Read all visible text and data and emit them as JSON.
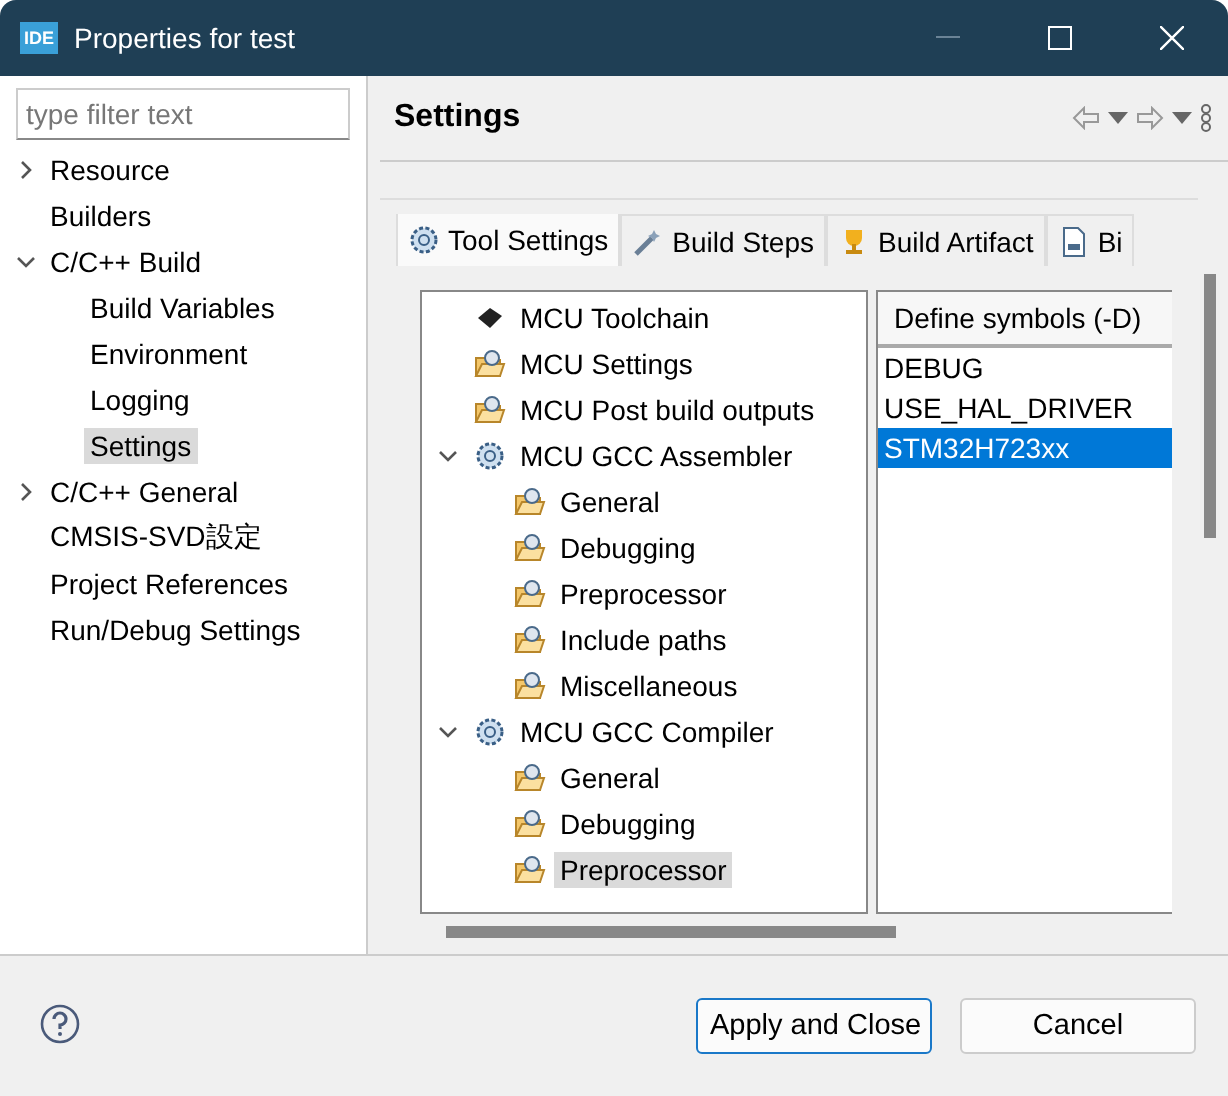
{
  "window": {
    "title": "Properties for test",
    "app_badge": "IDE"
  },
  "filter": {
    "placeholder": "type filter text"
  },
  "nav": [
    {
      "label": "Resource",
      "expanded": false,
      "selected": false
    },
    {
      "label": "Builders",
      "selected": false
    },
    {
      "label": "C/C++ Build",
      "expanded": true,
      "selected": false,
      "children": [
        {
          "label": "Build Variables",
          "selected": false
        },
        {
          "label": "Environment",
          "selected": false
        },
        {
          "label": "Logging",
          "selected": false
        },
        {
          "label": "Settings",
          "selected": true
        }
      ]
    },
    {
      "label": "C/C++ General",
      "expanded": false,
      "selected": false
    },
    {
      "label": "CMSIS-SVD設定",
      "selected": false
    },
    {
      "label": "Project References",
      "selected": false
    },
    {
      "label": "Run/Debug Settings",
      "selected": false
    }
  ],
  "page": {
    "title": "Settings"
  },
  "tabs": [
    {
      "label": "Tool Settings",
      "kind": "gear",
      "selected": true
    },
    {
      "label": "Build Steps",
      "kind": "wand",
      "selected": false
    },
    {
      "label": "Build Artifact",
      "kind": "trophy",
      "selected": false
    },
    {
      "label": "Bi",
      "kind": "binary",
      "selected": false
    }
  ],
  "tool_tree": [
    {
      "label": "MCU Toolchain",
      "kind": "chip",
      "selected": false
    },
    {
      "label": "MCU Settings",
      "kind": "folder",
      "selected": false
    },
    {
      "label": "MCU Post build outputs",
      "kind": "folder",
      "selected": false
    },
    {
      "label": "MCU GCC Assembler",
      "kind": "gear",
      "expanded": true,
      "selected": false,
      "children": [
        {
          "label": "General",
          "kind": "folder",
          "selected": false
        },
        {
          "label": "Debugging",
          "kind": "folder",
          "selected": false
        },
        {
          "label": "Preprocessor",
          "kind": "folder",
          "selected": false
        },
        {
          "label": "Include paths",
          "kind": "folder",
          "selected": false
        },
        {
          "label": "Miscellaneous",
          "kind": "folder",
          "selected": false
        }
      ]
    },
    {
      "label": "MCU GCC Compiler",
      "kind": "gear",
      "expanded": true,
      "selected": false,
      "children": [
        {
          "label": "General",
          "kind": "folder",
          "selected": false
        },
        {
          "label": "Debugging",
          "kind": "folder",
          "selected": false
        },
        {
          "label": "Preprocessor",
          "kind": "folder",
          "selected": true
        }
      ]
    }
  ],
  "symbols": {
    "header": "Define symbols (-D)",
    "items": [
      {
        "label": "DEBUG",
        "selected": false
      },
      {
        "label": "USE_HAL_DRIVER",
        "selected": false
      },
      {
        "label": "STM32H723xx",
        "selected": true
      }
    ]
  },
  "buttons": [
    {
      "label": "Apply and Close",
      "default": true
    },
    {
      "label": "Cancel",
      "default": false
    }
  ]
}
